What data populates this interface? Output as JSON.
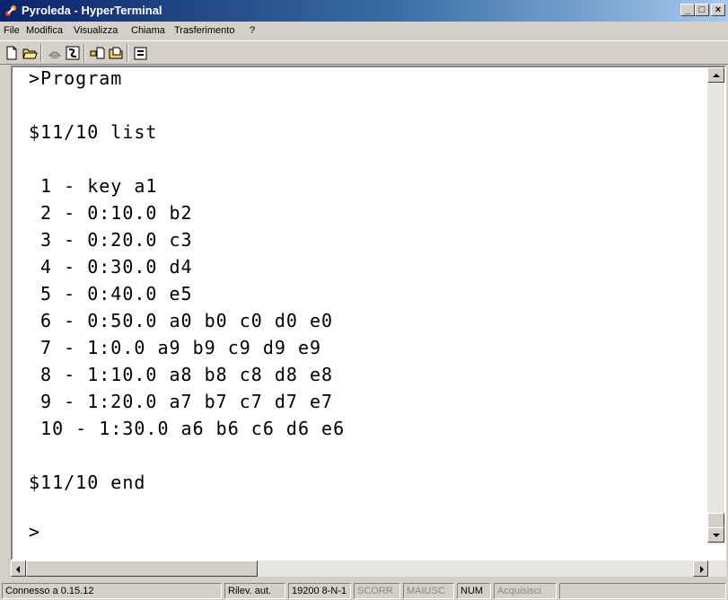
{
  "window": {
    "title": "Pyroleda - HyperTerminal"
  },
  "menu": [
    "File",
    "Modifica",
    "Visualizza",
    "Chiama",
    "Trasferimento",
    "?"
  ],
  "terminal": {
    "lines": [
      ">Program",
      "",
      "$11/10 list",
      "",
      " 1 - key a1",
      " 2 - 0:10.0 b2",
      " 3 - 0:20.0 c3",
      " 4 - 0:30.0 d4",
      " 5 - 0:40.0 e5",
      " 6 - 0:50.0 a0 b0 c0 d0 e0",
      " 7 - 1:0.0 a9 b9 c9 d9 e9",
      " 8 - 1:10.0 a8 b8 c8 d8 e8",
      " 9 - 1:20.0 a7 b7 c7 d7 e7",
      " 10 - 1:30.0 a6 b6 c6 d6 e6",
      "",
      "$11/10 end",
      "",
      ">"
    ]
  },
  "status": {
    "connection": "Connesso a 0.15.12",
    "detect": "Rilev. aut.",
    "settings": "19200 8-N-1",
    "scroll": "SCORR",
    "caps": "MAIUSC",
    "num": "NUM",
    "capture": "Acquisisci"
  }
}
